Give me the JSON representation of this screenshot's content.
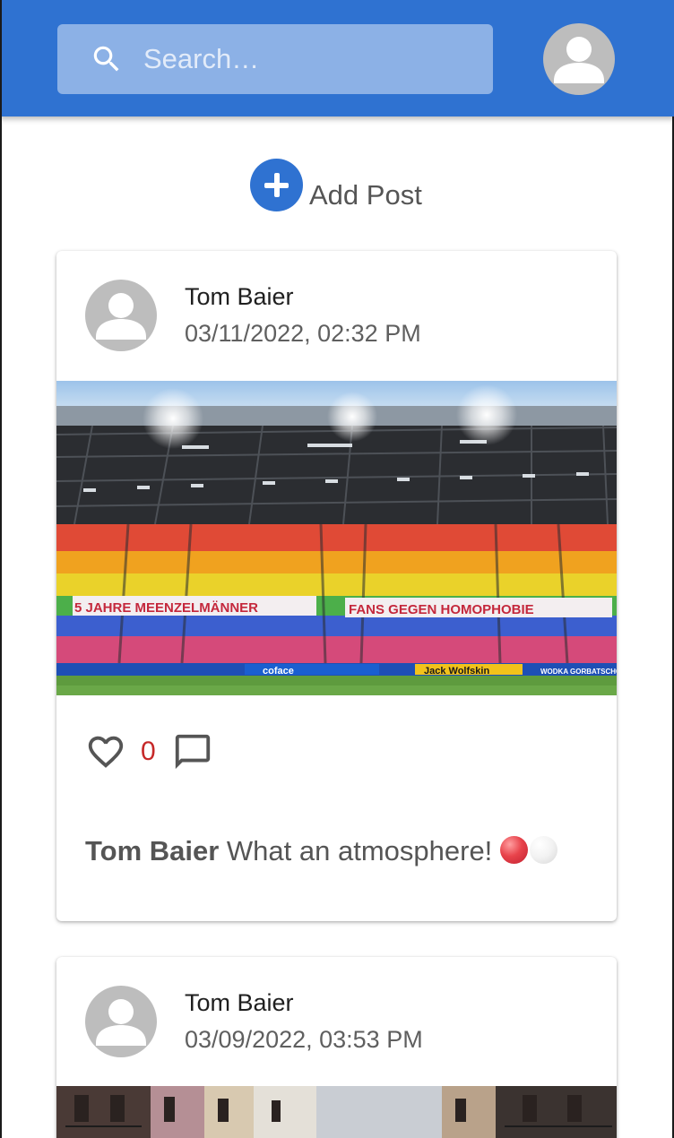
{
  "search": {
    "placeholder": "Search…"
  },
  "add_post": {
    "label": "Add Post"
  },
  "posts": [
    {
      "author": "Tom Baier",
      "date": "03/11/2022, 02:32 PM",
      "image": {
        "banners": [
          "5 JAHRE MEENZELMÄNNER",
          "FANS GEGEN HOMOPHOBIE"
        ],
        "ads": [
          "coface",
          "Jack Wolfskin",
          "WODKA GORBATSCHOW"
        ]
      },
      "likes": "0",
      "caption_author": "Tom Baier",
      "caption_text": "What an atmosphere!",
      "caption_emojis": [
        "red-circle",
        "white-circle"
      ]
    },
    {
      "author": "Tom Baier",
      "date": "03/09/2022, 03:53 PM"
    }
  ],
  "colors": {
    "appbar": "#2f72d1",
    "accent": "#2f72d1",
    "like_count": "#c62828",
    "avatar_bg": "#bdbdbd"
  }
}
